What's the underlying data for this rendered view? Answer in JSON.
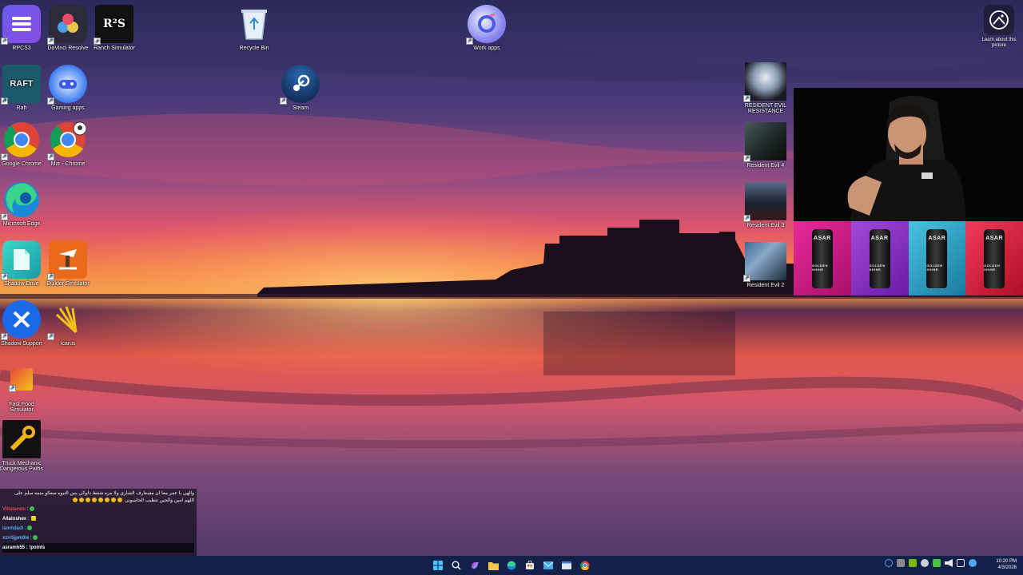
{
  "desktop": {
    "icons": [
      {
        "label": "RPCS3"
      },
      {
        "label": "DaVinci Resolve"
      },
      {
        "label": "Ranch Simulator"
      },
      {
        "label": "Recycle Bin"
      },
      {
        "label": "Work apps"
      },
      {
        "label": "Raft"
      },
      {
        "label": "Gaming apps"
      },
      {
        "label": "Steam"
      },
      {
        "label": "Google Chrome"
      },
      {
        "label": "Mzr - Chrome"
      },
      {
        "label": "Microsoft Edge"
      },
      {
        "label": "Shadow Drive"
      },
      {
        "label": "Builder Simulator"
      },
      {
        "label": "Shadow Support"
      },
      {
        "label": "Icarus"
      },
      {
        "label": "Fast Food Simulator"
      },
      {
        "label": "Truck Mechanic Dangerous Paths"
      },
      {
        "label": "RESIDENT EVIL RESISTANCE"
      },
      {
        "label": "Resident Evil 4"
      },
      {
        "label": "Resident Evil 3"
      },
      {
        "label": "Resident Evil 2"
      }
    ],
    "learn_about": "Learn about this picture"
  },
  "stream_overlay": {
    "ad_brand": "ASAR",
    "ad_subtitle": "GOLDEN SHINE",
    "ad_colors": [
      "#d11f8c",
      "#8a2ec0",
      "#2aa3c9",
      "#d61c3c"
    ]
  },
  "chat": {
    "messages": [
      {
        "text": "والهي يا عمر معا ان مشعارف الشاري ولا مره شفط ذلوكي بس النبوه سعكو منمه سلم على"
      },
      {
        "text": "اللهم امين والحين تتطيب الحاسوبي"
      },
      {
        "user": "Villatarsto",
        "text": ":"
      },
      {
        "user": "Allaloshex",
        "text": ":"
      },
      {
        "user": "lamhdadi",
        "text": ":"
      },
      {
        "user": "xzrr5jpm0le",
        "text": ":"
      },
      {
        "user": "asramh55",
        "text": ": !points"
      }
    ]
  },
  "clock": {
    "time": "10:20 PM",
    "date": "4/3/2026"
  },
  "colors": {
    "taskbar": "#13204a",
    "accent": "#0a84ff"
  }
}
